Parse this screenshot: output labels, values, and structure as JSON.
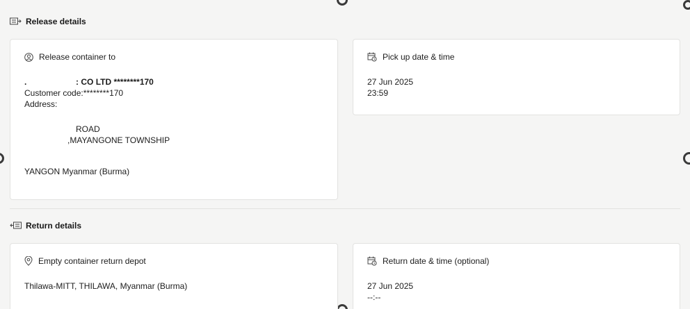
{
  "release": {
    "header": "Release details",
    "container_card": {
      "title": "Release container to",
      "company_prefix": ".",
      "company_name": ": CO LTD ********170",
      "customer_code": "Customer code:********170",
      "address_label": "Address:",
      "address_line1": "ROAD",
      "address_line2": ",MAYANGONE TOWNSHIP",
      "address_line3": "YANGON Myanmar (Burma)"
    },
    "pickup_card": {
      "title": "Pick up date & time",
      "date": "27 Jun 2025",
      "time": "23:59"
    }
  },
  "return": {
    "header": "Return details",
    "depot_card": {
      "title": "Empty container return depot",
      "depot": "Thilawa-MITT, THILAWA, Myanmar (Burma)"
    },
    "return_date_card": {
      "title": "Return date & time (optional)",
      "date": "27 Jun 2025",
      "time": "--:--"
    }
  },
  "icons": {
    "release": "release-arrow-icon",
    "return": "return-arrow-icon",
    "user": "user-circle-icon",
    "calendar": "calendar-clock-icon",
    "location": "location-pin-icon"
  }
}
